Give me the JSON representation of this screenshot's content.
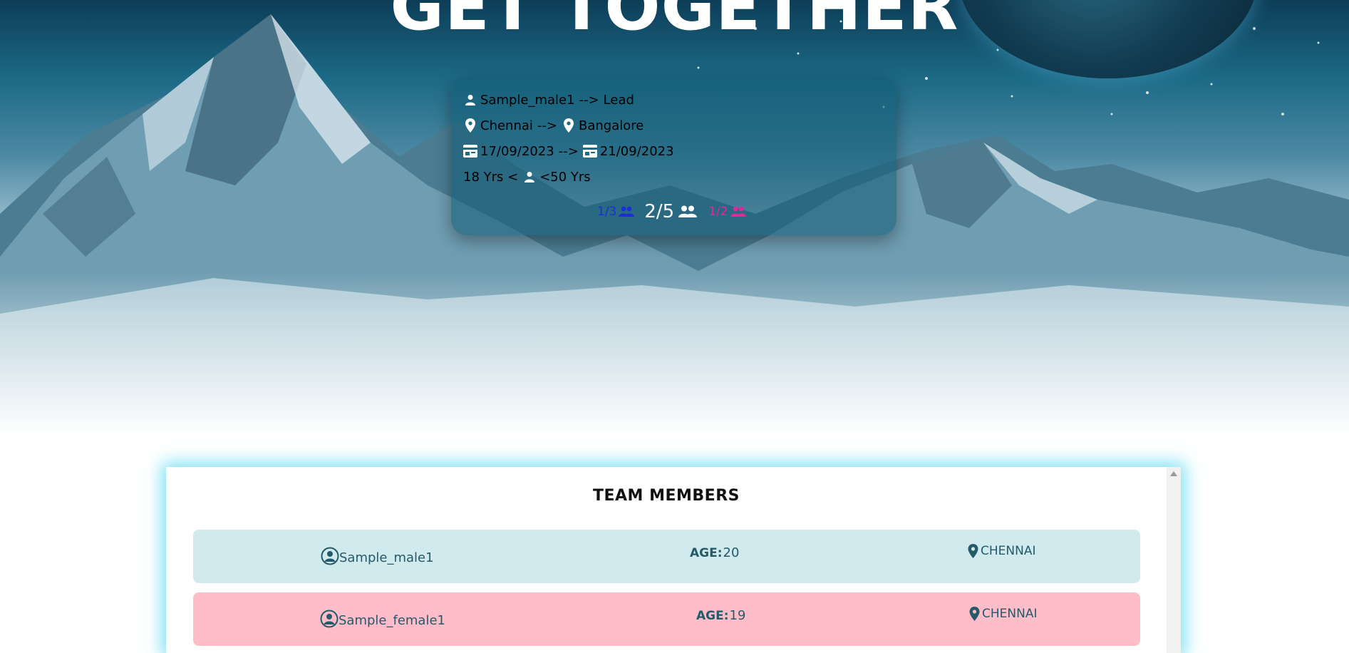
{
  "hero": {
    "title": "GET TOGETHER"
  },
  "trip_card": {
    "lead_name": "Sample_male1",
    "lead_arrow": "-->",
    "lead_role": "Lead",
    "from_city": "Chennai",
    "route_arrow": "-->",
    "to_city": "Bangalore",
    "start_date": "17/09/2023",
    "date_arrow": "-->",
    "end_date": "21/09/2023",
    "min_age": "18 Yrs <",
    "max_age": "<50 Yrs",
    "male_count": "1/3",
    "total_count": "2/5",
    "female_count": "1/2"
  },
  "team": {
    "title": "TEAM MEMBERS",
    "age_label": "AGE:",
    "members": [
      {
        "name": "Sample_male1",
        "age": "20",
        "city": "CHENNAI"
      },
      {
        "name": "Sample_female1",
        "age": "19",
        "city": "CHENNAI"
      }
    ]
  },
  "colors": {
    "male_count": "#1c2fd6",
    "female_count": "#e0289a",
    "male_row": "#d0eaee",
    "female_row": "#ffbdca",
    "member_text": "#245a6a",
    "panel_glow": "#50d7f0"
  },
  "icons": [
    "user-icon",
    "map-pin-icon",
    "id-card-icon",
    "users-icon",
    "user-circle-icon"
  ]
}
